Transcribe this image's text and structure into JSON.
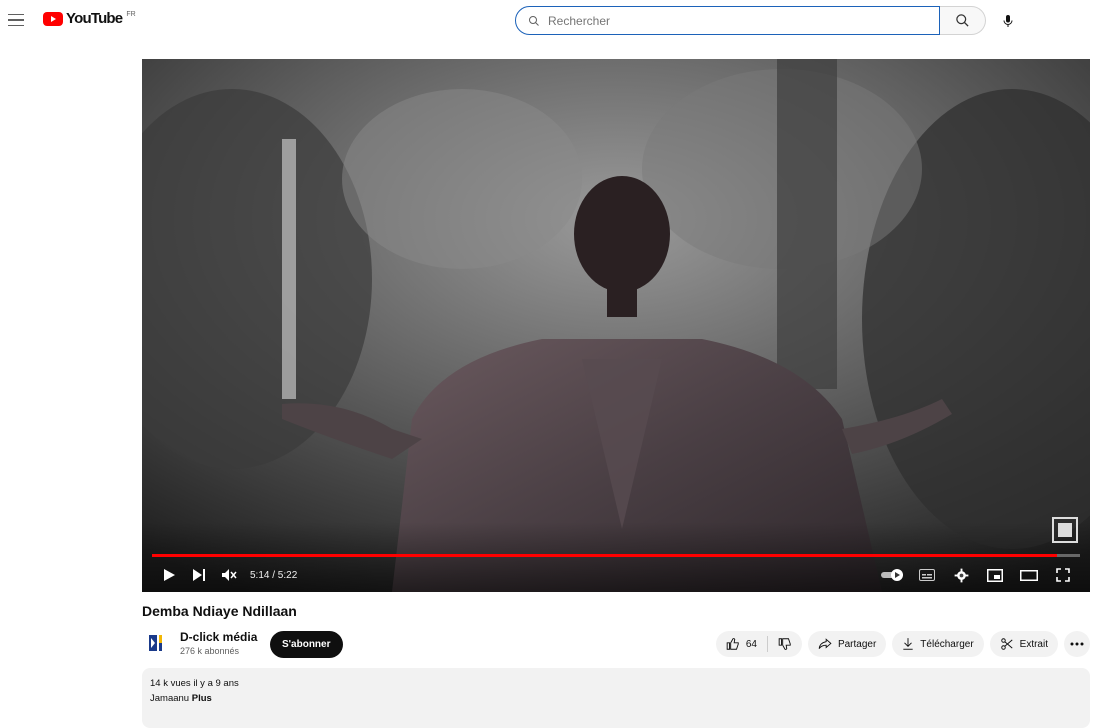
{
  "header": {
    "logo_text": "YouTube",
    "region": "FR",
    "search_placeholder": "Rechercher"
  },
  "player": {
    "current_time": "5:14",
    "duration": "5:22",
    "time_display": "5:14 / 5:22",
    "progress": 0.975,
    "accent_color": "#ff0000"
  },
  "video": {
    "title": "Demba Ndiaye Ndillaan"
  },
  "channel": {
    "name": "D-click média",
    "subscribers": "276 k abonnés",
    "subscribe_label": "S'abonner"
  },
  "actions": {
    "like_count": "64",
    "share_label": "Partager",
    "download_label": "Télécharger",
    "clip_label": "Extrait"
  },
  "description": {
    "views": "14 k vues",
    "age": "il y a 9 ans",
    "text": "Jamaanu",
    "more_label": "Plus"
  }
}
